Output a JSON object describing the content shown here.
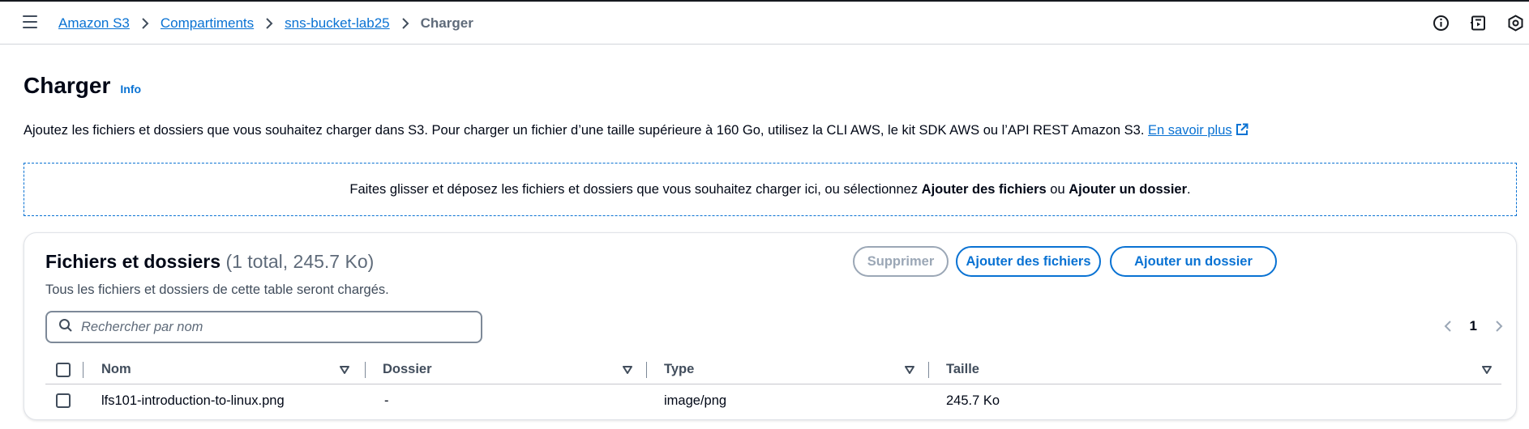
{
  "breadcrumb": {
    "items": [
      "Amazon S3",
      "Compartiments",
      "sns-bucket-lab25"
    ],
    "current": "Charger"
  },
  "header": {
    "title": "Charger",
    "info": "Info",
    "description": "Ajoutez les fichiers et dossiers que vous souhaitez charger dans S3. Pour charger un fichier d’une taille supérieure à 160 Go, utilisez la CLI AWS, le kit SDK AWS ou l’API REST Amazon S3. ",
    "learn_more": "En savoir plus"
  },
  "dropzone": {
    "text_before": "Faites glisser et déposez les fichiers et dossiers que vous souhaitez charger ici, ou sélectionnez ",
    "add_files": "Ajouter des fichiers",
    "or": " ou ",
    "add_folder": "Ajouter un dossier",
    "end": "."
  },
  "files_panel": {
    "title": "Fichiers et dossiers",
    "count": "(1 total, 245.7 Ko)",
    "description": "Tous les fichiers et dossiers de cette table seront chargés.",
    "delete_button": "Supprimer",
    "add_files_button": "Ajouter des fichiers",
    "add_folder_button": "Ajouter un dossier",
    "search_placeholder": "Rechercher par nom",
    "page": "1"
  },
  "table": {
    "columns": [
      "Nom",
      "Dossier",
      "Type",
      "Taille"
    ],
    "rows": [
      {
        "name": "lfs101-introduction-to-linux.png",
        "folder": "-",
        "type": "image/png",
        "size": "245.7 Ko"
      }
    ]
  },
  "icons": {
    "menu": "hamburger-menu-icon",
    "info": "info-circle-icon",
    "notifications": "notification-panel-icon",
    "settings": "settings-icon",
    "search": "search-icon",
    "external": "external-link-icon"
  },
  "colors": {
    "link": "#0972d3",
    "text": "#000716",
    "muted": "#5f6b7a",
    "disabled": "#9ba7b6"
  }
}
